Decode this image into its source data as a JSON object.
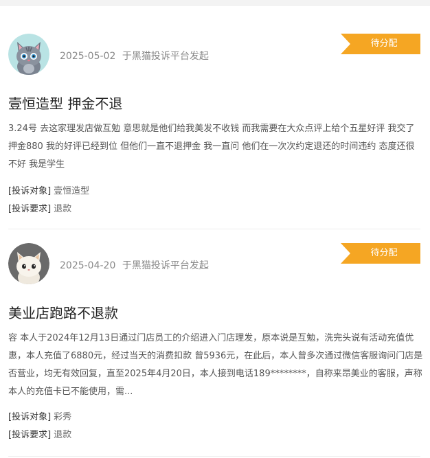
{
  "complaints": [
    {
      "avatar": "gray-cat-avatar",
      "date": "2025-05-02",
      "source": "于黑猫投诉平台发起",
      "status": "待分配",
      "title": "壹恒造型 押金不退",
      "description": "3.24号 去这家理发店做互勉 意思就是他们给我美发不收钱 而我需要在大众点评上给个五星好评 我交了押金880 我的好评已经到位 但他们一直不退押金 我一直问 他们在一次次约定退还的时间违约 态度还很不好 我是学生",
      "target_label": "[投诉对象]",
      "target_value": "壹恒造型",
      "demand_label": "[投诉要求]",
      "demand_value": "退款"
    },
    {
      "avatar": "white-cat-avatar",
      "date": "2025-04-20",
      "source": "于黑猫投诉平台发起",
      "status": "待分配",
      "title": "美业店跑路不退款",
      "description": "容 本人于2024年12月13日通过门店员工的介绍进入门店理发，原本说是互勉，洗完头说有活动充值优惠，本人充值了6880元，经过当天的消费扣款 曾5936元，在此后，本人曾多次通过微信客服询问门店是否营业，均无有效回复，直至2025年4月20日，本人接到电话189********，自称来昂美业的客服，声称本人的充值卡已不能使用，需...",
      "target_label": "[投诉对象]",
      "target_value": "彩秀",
      "demand_label": "[投诉要求]",
      "demand_value": "退款"
    }
  ],
  "colors": {
    "status_bg": "#f5a623",
    "divider": "#ececec"
  }
}
